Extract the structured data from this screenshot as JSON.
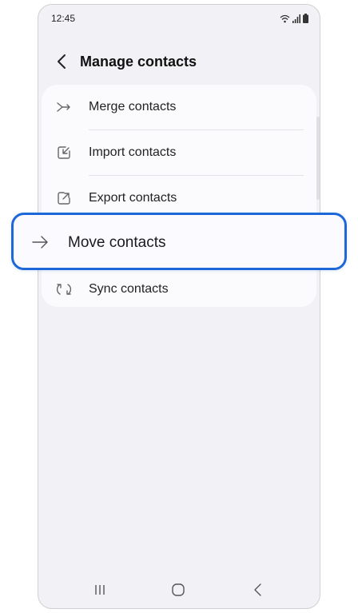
{
  "status_bar": {
    "time": "12:45",
    "icons": [
      "wifi-icon",
      "signal-icon",
      "battery-icon"
    ]
  },
  "header": {
    "back_icon": "chevron-left-icon",
    "title": "Manage contacts"
  },
  "menu": {
    "items": [
      {
        "label": "Merge contacts",
        "icon": "merge-icon"
      },
      {
        "label": "Import contacts",
        "icon": "import-icon"
      },
      {
        "label": "Export contacts",
        "icon": "export-icon"
      },
      {
        "label": "Move contacts",
        "icon": "arrow-right-icon",
        "highlighted": true
      },
      {
        "label": "Sync contacts",
        "icon": "sync-icon"
      }
    ]
  },
  "navigation_bar": {
    "buttons": [
      "recents-icon",
      "home-icon",
      "back-icon"
    ]
  },
  "colors": {
    "highlight_border": "#1e67d8",
    "background": "#f2f2f6",
    "card": "#fbfbfd"
  }
}
